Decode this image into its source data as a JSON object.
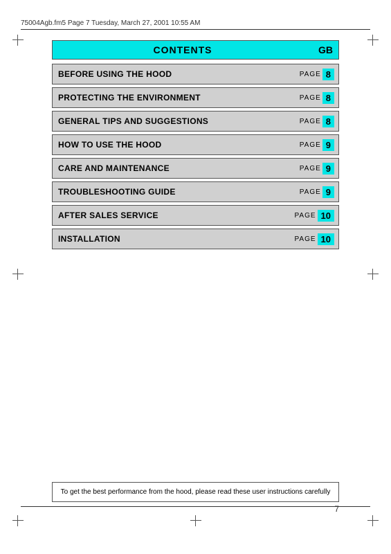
{
  "header": {
    "file_info": "75004Agb.fm5  Page 7  Tuesday, March 27, 2001  10:55 AM"
  },
  "contents": {
    "title": "CONTENTS",
    "gb_label": "GB",
    "rows": [
      {
        "label": "BEFORE USING THE HOOD",
        "page_word": "PAGE",
        "page_num": "8"
      },
      {
        "label": "PROTECTING THE ENVIRONMENT",
        "page_word": "PAGE",
        "page_num": "8"
      },
      {
        "label": "GENERAL TIPS AND SUGGESTIONS",
        "page_word": "PAGE",
        "page_num": "8"
      },
      {
        "label": "HOW TO USE THE HOOD",
        "page_word": "PAGE",
        "page_num": "9"
      },
      {
        "label": "CARE AND MAINTENANCE",
        "page_word": "PAGE",
        "page_num": "9"
      },
      {
        "label": "TROUBLESHOOTING GUIDE",
        "page_word": "PAGE",
        "page_num": "9"
      },
      {
        "label": "AFTER SALES SERVICE",
        "page_word": "PAGE",
        "page_num": "10"
      },
      {
        "label": "INSTALLATION",
        "page_word": "PAGE",
        "page_num": "10"
      }
    ]
  },
  "bottom_note": {
    "text": "To get the best performance from the hood, please read these user instructions carefully"
  },
  "page_number": "7"
}
